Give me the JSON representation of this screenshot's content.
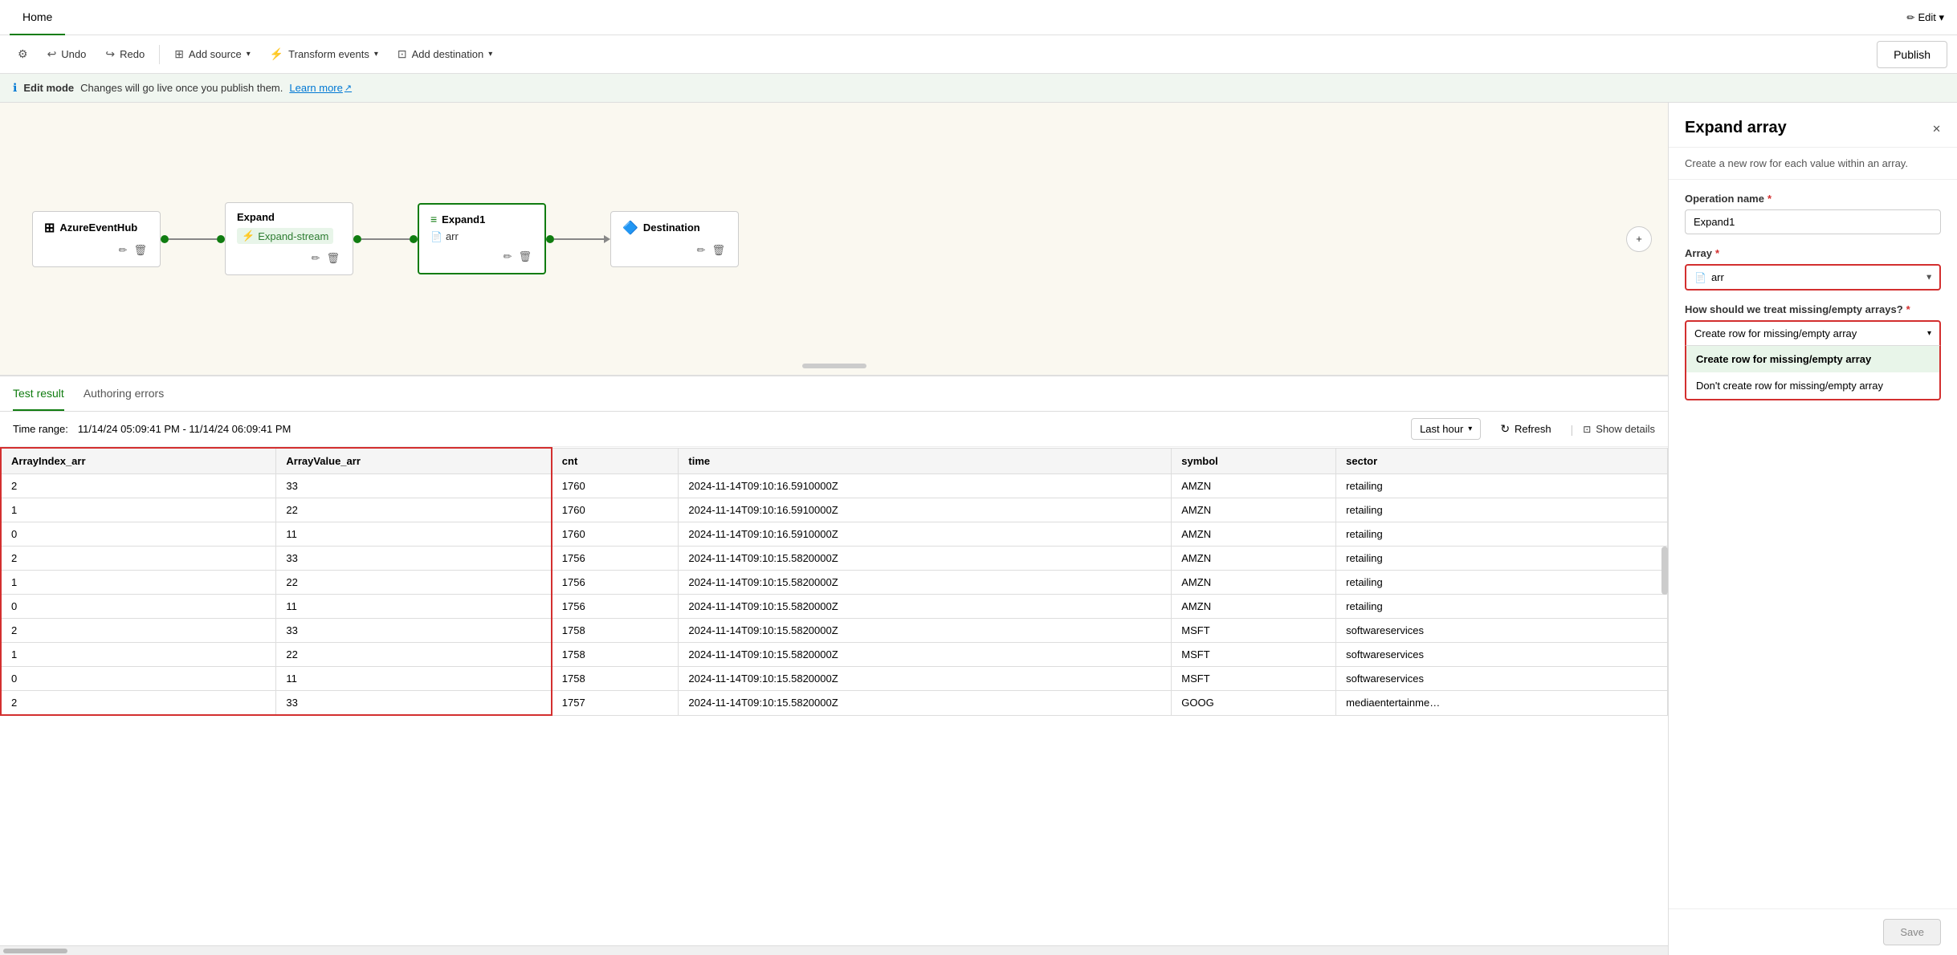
{
  "header": {
    "tab_home": "Home",
    "edit_label": "Edit ▾"
  },
  "toolbar": {
    "settings_icon": "⚙",
    "undo_label": "Undo",
    "redo_label": "Redo",
    "add_source_label": "Add source",
    "transform_events_label": "Transform events",
    "add_destination_label": "Add destination",
    "publish_label": "Publish"
  },
  "info_bar": {
    "icon": "ℹ",
    "edit_mode": "Edit mode",
    "message": "Changes will go live once you publish them.",
    "learn_more": "Learn more",
    "learn_more_icon": "↗"
  },
  "flow": {
    "source_node": {
      "title": "AzureEventHub"
    },
    "expand_node": {
      "title": "Expand",
      "stream_label": "Expand-stream"
    },
    "expand1_node": {
      "title": "Expand1",
      "arr_label": "arr"
    },
    "destination_node": {
      "title": "Destination"
    },
    "plus_btn": "+"
  },
  "bottom_panel": {
    "tabs": [
      "Test result",
      "Authoring errors"
    ],
    "active_tab": "Test result",
    "time_range_label": "Time range:",
    "time_range_value": "11/14/24 05:09:41 PM - 11/14/24 06:09:41 PM",
    "time_selector": "Last hour",
    "refresh_label": "Refresh",
    "show_details_label": "Show details",
    "columns": [
      "ArrayIndex_arr",
      "ArrayValue_arr",
      "cnt",
      "time",
      "symbol",
      "sector"
    ],
    "rows": [
      [
        "2",
        "33",
        "1760",
        "2024-11-14T09:10:16.5910000Z",
        "AMZN",
        "retailing"
      ],
      [
        "1",
        "22",
        "1760",
        "2024-11-14T09:10:16.5910000Z",
        "AMZN",
        "retailing"
      ],
      [
        "0",
        "11",
        "1760",
        "2024-11-14T09:10:16.5910000Z",
        "AMZN",
        "retailing"
      ],
      [
        "2",
        "33",
        "1756",
        "2024-11-14T09:10:15.5820000Z",
        "AMZN",
        "retailing"
      ],
      [
        "1",
        "22",
        "1756",
        "2024-11-14T09:10:15.5820000Z",
        "AMZN",
        "retailing"
      ],
      [
        "0",
        "11",
        "1756",
        "2024-11-14T09:10:15.5820000Z",
        "AMZN",
        "retailing"
      ],
      [
        "2",
        "33",
        "1758",
        "2024-11-14T09:10:15.5820000Z",
        "MSFT",
        "softwareservices"
      ],
      [
        "1",
        "22",
        "1758",
        "2024-11-14T09:10:15.5820000Z",
        "MSFT",
        "softwareservices"
      ],
      [
        "0",
        "11",
        "1758",
        "2024-11-14T09:10:15.5820000Z",
        "MSFT",
        "softwareservices"
      ],
      [
        "2",
        "33",
        "1757",
        "2024-11-14T09:10:15.5820000Z",
        "GOOG",
        "mediaentertainme…"
      ]
    ]
  },
  "right_panel": {
    "title": "Expand array",
    "description": "Create a new row for each value within an array.",
    "close_icon": "✕",
    "operation_name_label": "Operation name",
    "operation_name_value": "Expand1",
    "array_label": "Array",
    "array_value": "arr",
    "missing_array_label": "How should we treat missing/empty arrays?",
    "missing_array_value": "Create row for missing/empty array",
    "dropdown_options": [
      "Create row for missing/empty array",
      "Don't create row for missing/empty array"
    ],
    "save_label": "Save"
  }
}
